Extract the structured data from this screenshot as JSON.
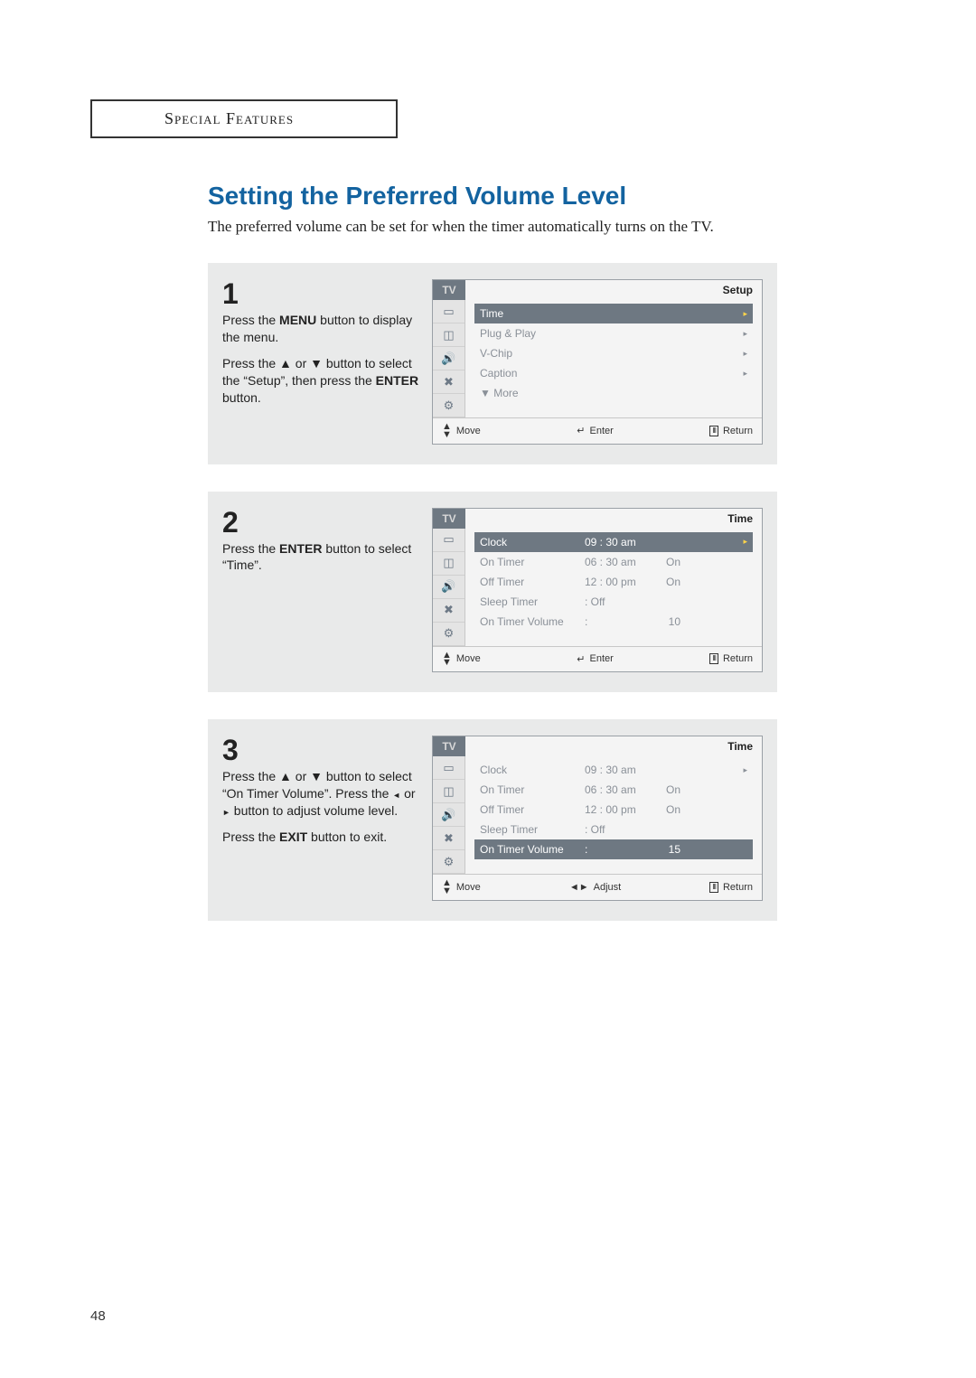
{
  "section_header": "Special Features",
  "headline": "Setting the Preferred Volume Level",
  "intro": "The preferred volume can be set for when the timer automatically turns on the TV.",
  "page_number": "48",
  "glyphs": {
    "up": "▲",
    "down": "▼",
    "left": "◄",
    "right": "►",
    "lr": "◄►",
    "caretr": "▸"
  },
  "steps": {
    "1": {
      "num": "1",
      "p1a": "Press the ",
      "p1b": "MENU",
      "p1c": " button to display the menu.",
      "p2a": "Press the ",
      "p2b": " or ",
      "p2c": " button to select the “Setup”, then press the ",
      "p2d": "ENTER",
      "p2e": " button."
    },
    "2": {
      "num": "2",
      "p1a": "Press the ",
      "p1b": "ENTER",
      "p1c": " button to select “Time”."
    },
    "3": {
      "num": "3",
      "p1a": "Press the ",
      "p1b": " or ",
      "p1c": " button to select “On Timer Volume”. Press the ",
      "p1d": " or ",
      "p1e": " button to adjust volume level.",
      "p2a": "Press the ",
      "p2b": "EXIT",
      "p2c": " button to exit."
    }
  },
  "osd1": {
    "tv": "TV",
    "title": "Setup",
    "rows": [
      {
        "label": "Time",
        "sel": true
      },
      {
        "label": "Plug & Play"
      },
      {
        "label": "V-Chip"
      },
      {
        "label": "Caption"
      },
      {
        "label": "▼ More"
      }
    ],
    "footer": {
      "move": "Move",
      "enter": "Enter",
      "enter_glyph": "↵",
      "ret": "Return"
    }
  },
  "osd2": {
    "tv": "TV",
    "title": "Time",
    "rows": [
      {
        "label": "Clock",
        "val": "09 : 30 am",
        "sel": true
      },
      {
        "label": "On Timer",
        "val": "06 : 30 am",
        "st": "On"
      },
      {
        "label": "Off Timer",
        "val": "12 : 00 pm",
        "st": "On"
      },
      {
        "label": "Sleep Timer",
        "val": ": Off"
      },
      {
        "label": "On Timer Volume",
        "val": ":",
        "st": "10"
      }
    ],
    "footer": {
      "move": "Move",
      "enter": "Enter",
      "enter_glyph": "↵",
      "ret": "Return"
    }
  },
  "osd3": {
    "tv": "TV",
    "title": "Time",
    "rows": [
      {
        "label": "Clock",
        "val": "09 : 30 am"
      },
      {
        "label": "On Timer",
        "val": "06 : 30 am",
        "st": "On"
      },
      {
        "label": "Off Timer",
        "val": "12 : 00 pm",
        "st": "On"
      },
      {
        "label": "Sleep Timer",
        "val": ": Off"
      },
      {
        "label": "On Timer Volume",
        "val": ":",
        "st": "15",
        "sel": true
      }
    ],
    "footer": {
      "move": "Move",
      "adjust": "Adjust",
      "ret": "Return"
    }
  },
  "icons": [
    "picture-icon",
    "input-icon",
    "sound-icon",
    "channel-icon",
    "setup-icon"
  ]
}
